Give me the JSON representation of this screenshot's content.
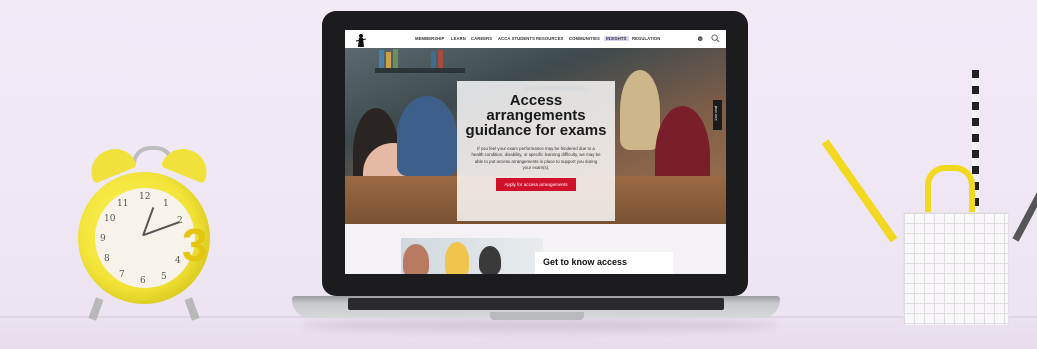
{
  "nav": {
    "items": [
      "MEMBERSHIP",
      "LEARN",
      "CAREERS",
      "ACCA STUDENTS",
      "RESOURCES",
      "COMMUNITIES",
      "INSIGHTS",
      "REGULATION"
    ],
    "active_item": "INSIGHTS",
    "icons": [
      "user-icon",
      "search-icon"
    ]
  },
  "hero": {
    "title": "Access arrangements guidance for exams",
    "body": "If you feel your exam performance may be hindered due to a health condition, disability, or specific learning difficulty, we may be able to put access arrangements in place to support you during your exam(s).",
    "cta_label": "Apply for access arrangements",
    "side_tab": "Live chat"
  },
  "lower": {
    "teaser_title": "Get to know access"
  },
  "colors": {
    "accent": "#d0112b",
    "active_nav_bg": "#dcd6f6"
  },
  "clock": {
    "numbers": [
      "12",
      "1",
      "2",
      "3",
      "4",
      "5",
      "6",
      "7",
      "8",
      "9",
      "10",
      "11"
    ],
    "badge": "3"
  }
}
